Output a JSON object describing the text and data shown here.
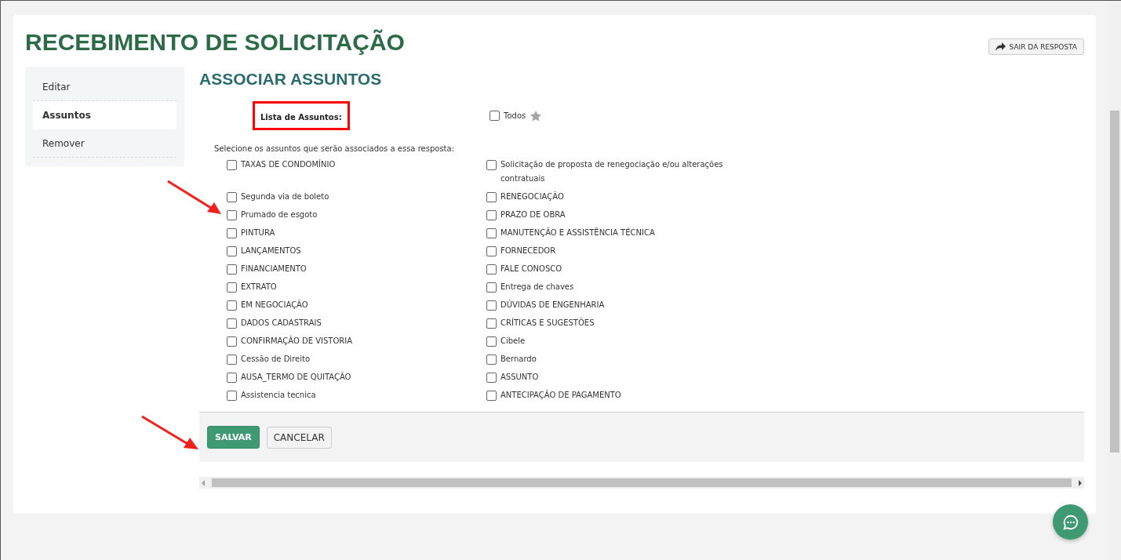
{
  "title": "RECEBIMENTO DE SOLICITAÇÃO",
  "exit_button": {
    "label": "SAIR DA RESPOSTA"
  },
  "sidebar": {
    "items": [
      {
        "label": "Editar",
        "selected": false
      },
      {
        "label": "Assuntos",
        "selected": true
      },
      {
        "label": "Remover",
        "selected": false
      }
    ]
  },
  "section_title": "ASSOCIAR ASSUNTOS",
  "list_label": "Lista de Assuntos:",
  "all_checkbox": {
    "label": "Todos",
    "checked": false
  },
  "instruction": "Selecione os assuntos que serão associados a essa resposta:",
  "subjects": [
    {
      "label": "TAXAS DE CONDOMÍNIO",
      "checked": false
    },
    {
      "label": "Solicitação de proposta de renegociação e/ou alterações contratuais",
      "checked": false
    },
    {
      "label": "Segunda via de boleto",
      "checked": false
    },
    {
      "label": "RENEGOCIAÇÃO",
      "checked": false
    },
    {
      "label": "Prumado de esgoto",
      "checked": false
    },
    {
      "label": "PRAZO DE OBRA",
      "checked": false
    },
    {
      "label": "PINTURA",
      "checked": false
    },
    {
      "label": "MANUTENÇÃO E ASSISTÊNCIA TÉCNICA",
      "checked": false
    },
    {
      "label": "LANÇAMENTOS",
      "checked": false
    },
    {
      "label": "FORNECEDOR",
      "checked": false
    },
    {
      "label": "FINANCIAMENTO",
      "checked": false
    },
    {
      "label": "FALE CONOSCO",
      "checked": false
    },
    {
      "label": "EXTRATO",
      "checked": false
    },
    {
      "label": "Entrega de chaves",
      "checked": false
    },
    {
      "label": "EM NEGOCIAÇÃO",
      "checked": false
    },
    {
      "label": "DÚVIDAS DE ENGENHARIA",
      "checked": false
    },
    {
      "label": "DADOS CADASTRAIS",
      "checked": false
    },
    {
      "label": "CRÍTICAS E SUGESTÕES",
      "checked": false
    },
    {
      "label": "CONFIRMAÇÃO DE VISTORIA",
      "checked": false
    },
    {
      "label": "Cibele",
      "checked": false
    },
    {
      "label": "Cessão de Direito",
      "checked": false
    },
    {
      "label": "Bernardo",
      "checked": false
    },
    {
      "label": "AUSA_TERMO DE QUITAÇÃO",
      "checked": false
    },
    {
      "label": "ASSUNTO",
      "checked": false
    },
    {
      "label": "Assistencia tecnica",
      "checked": false
    },
    {
      "label": "ANTECIPAÇÃO DE PAGAMENTO",
      "checked": false
    }
  ],
  "buttons": [
    {
      "label": "SALVAR",
      "kind": "primary"
    },
    {
      "label": "CANCELAR",
      "kind": "secondary"
    }
  ]
}
